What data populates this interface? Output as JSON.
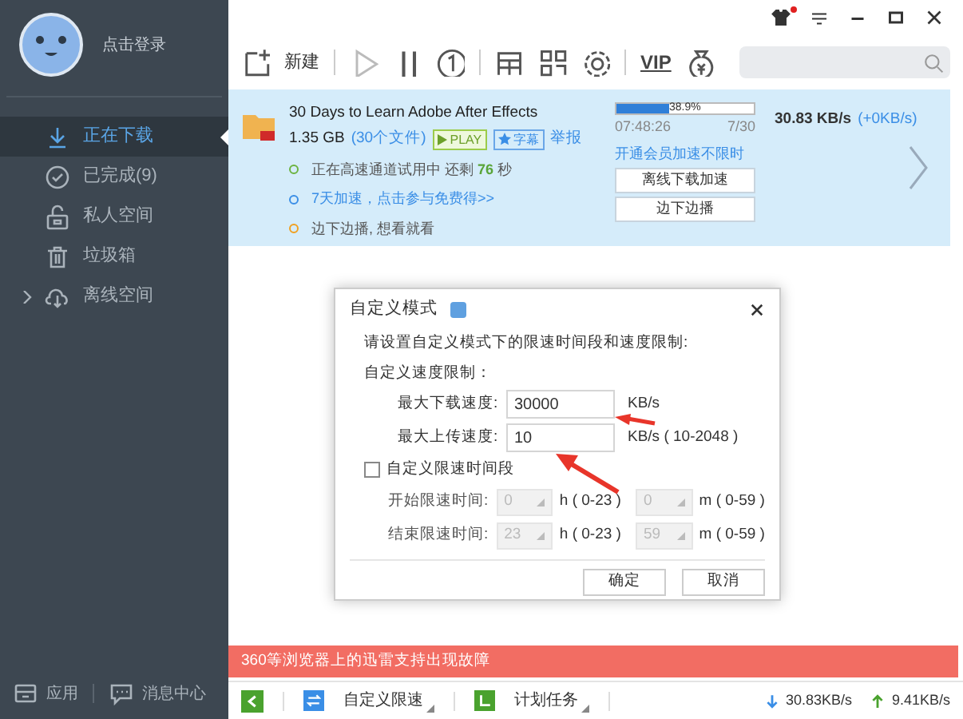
{
  "sidebar": {
    "login": "点击登录",
    "items": [
      {
        "label": "正在下载",
        "selected": true
      },
      {
        "label": "已完成(9)",
        "selected": false
      },
      {
        "label": "私人空间",
        "selected": false
      },
      {
        "label": "垃圾箱",
        "selected": false
      },
      {
        "label": "离线空间",
        "selected": false,
        "expanded": false
      }
    ],
    "footer": [
      "应用",
      "消息中心"
    ]
  },
  "toolbar": {
    "new_label": "新建",
    "vip_label": "VIP"
  },
  "task": {
    "name": "30 Days to Learn Adobe After Effects",
    "size": "1.35 GB",
    "files": "(30个文件)",
    "play": "PLAY",
    "subtitle": "字幕",
    "report": "举报",
    "progress_text": "38.9%",
    "level": 0.389,
    "elapsed": "07:48:26",
    "count": "7/30",
    "speed": "30.83  KB/s",
    "speed_delta": "(+0KB/s)",
    "notes": [
      {
        "text": "正在高速通道试用中  还剩 ",
        "highlight": "76",
        "suffix": " 秒",
        "color": "#6cb33f"
      },
      {
        "text": "7天加速，点击参与免费得>>",
        "color": "#3a8ee6"
      },
      {
        "text": "边下边播, 想看就看",
        "color": "#f0a020"
      }
    ],
    "member_link": "开通会员加速不限时",
    "buttons": [
      "离线下载加速",
      "边下边播"
    ]
  },
  "dialog": {
    "title": "自定义模式",
    "intro": "请设置自定义模式下的限速时间段和速度限制:",
    "section": "自定义速度限制：",
    "fields": [
      {
        "label": "最大下载速度:",
        "value": "30000",
        "unit": "KB/s"
      },
      {
        "label": "最大上传速度:",
        "value": "10",
        "unit": "KB/s ( 10-2048 )"
      }
    ],
    "time_limit": {
      "label": "自定义限速时间段",
      "checked": false,
      "rows": [
        {
          "label": "开始限速时间:",
          "hour": "0",
          "hour_range": "h ( 0-23 )",
          "minute": "0",
          "minute_range": "m ( 0-59 )"
        },
        {
          "label": "结束限速时间:",
          "hour": "23",
          "hour_range": "h ( 0-23 )",
          "minute": "59",
          "minute_range": "m ( 0-59 )"
        }
      ]
    },
    "buttons": [
      "确定",
      "取消"
    ]
  },
  "notice": "360等浏览器上的迅雷支持出现故障",
  "status_bar": {
    "items": [
      "自定义限速",
      "计划任务"
    ],
    "download": "30.83KB/s",
    "upload": "9.41KB/s"
  }
}
